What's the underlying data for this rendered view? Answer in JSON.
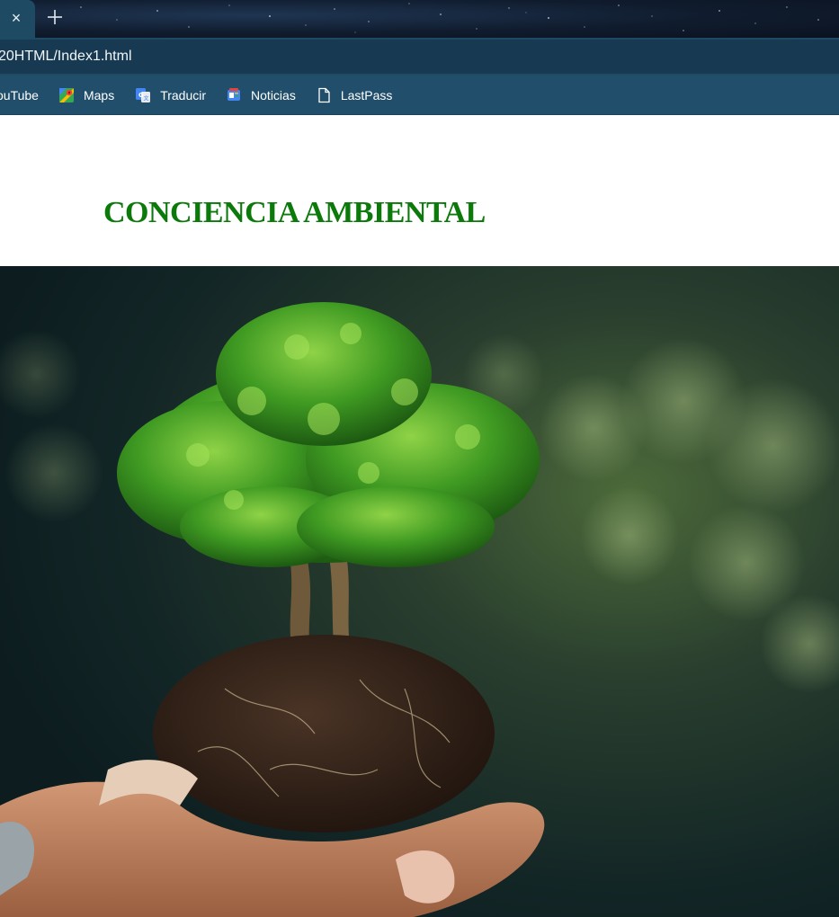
{
  "browser": {
    "tab": {
      "close_glyph": "×",
      "new_tab_icon": "plus-icon"
    },
    "address": {
      "url": "20HTML/Index1.html"
    },
    "bookmarks": [
      {
        "label": "ouTube",
        "icon": "youtube-icon"
      },
      {
        "label": "Maps",
        "icon": "maps-icon"
      },
      {
        "label": "Traducir",
        "icon": "translate-icon"
      },
      {
        "label": "Noticias",
        "icon": "news-icon"
      },
      {
        "label": "LastPass",
        "icon": "page-icon"
      }
    ]
  },
  "page": {
    "title": "CONCIENCIA AMBIENTAL",
    "title_color": "#0b7a0b",
    "hero_image": "photo-hands-holding-tree-with-soil"
  },
  "colors": {
    "tab_bg": "#1f4a63",
    "address_bg": "#173a52",
    "bookmark_bar_bg": "#214e6a"
  }
}
